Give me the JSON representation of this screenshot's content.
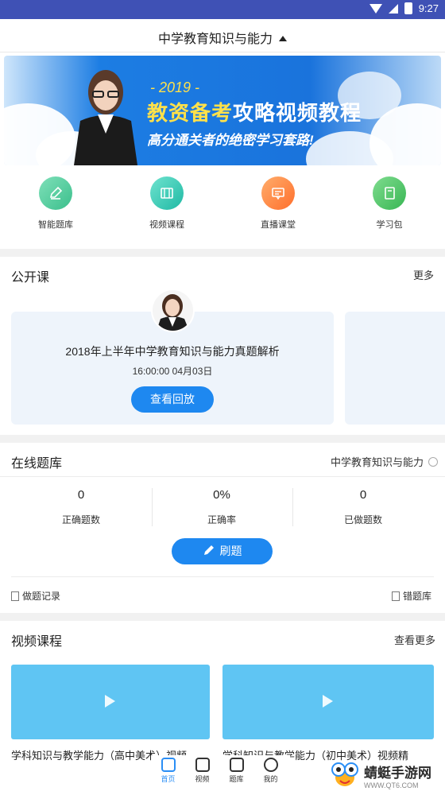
{
  "status": {
    "time": "9:27",
    "battery": ""
  },
  "header": {
    "title": "中学教育知识与能力"
  },
  "banner": {
    "year": "- 2019 -",
    "headline_hl": "教资备考",
    "headline_rest": "攻略视频教程",
    "subtitle": "高分通关者的绝密学习套路!"
  },
  "quick": [
    {
      "label": "智能题库",
      "icon": "pencil-icon",
      "color": "#4dcf9e"
    },
    {
      "label": "视频课程",
      "icon": "film-icon",
      "color": "#35cdb6"
    },
    {
      "label": "直播课堂",
      "icon": "chat-screen-icon",
      "color": "#ff8a3d"
    },
    {
      "label": "学习包",
      "icon": "book-icon",
      "color": "#4cc76a"
    }
  ],
  "open_course": {
    "title": "公开课",
    "more": "更多",
    "card": {
      "name": "2018年上半年中学教育知识与能力真题解析",
      "time": "16:00:00  04月03日",
      "button": "查看回放"
    }
  },
  "question_bank": {
    "title": "在线题库",
    "subject": "中学教育知识与能力",
    "stats": [
      {
        "value": "0",
        "label": "正确题数"
      },
      {
        "value": "0%",
        "label": "正确率"
      },
      {
        "value": "0",
        "label": "已做题数"
      }
    ],
    "button": "刷题",
    "record": "做题记录",
    "wrong": "错题库"
  },
  "video_course": {
    "title": "视频课程",
    "more": "查看更多",
    "items": [
      {
        "title": "学科知识与教学能力（高中美术）视频"
      },
      {
        "title": "学科知识与教学能力（初中美术）视频精"
      }
    ]
  },
  "bottom_nav": [
    {
      "label": "首页",
      "icon": "home-icon",
      "active": true
    },
    {
      "label": "视频",
      "icon": "tv-icon",
      "active": false
    },
    {
      "label": "题库",
      "icon": "bookmark-icon",
      "active": false
    },
    {
      "label": "我的",
      "icon": "user-icon",
      "active": false
    }
  ],
  "watermark": {
    "name": "蜻蜓手游网",
    "url": "WWW.QT6.COM"
  }
}
